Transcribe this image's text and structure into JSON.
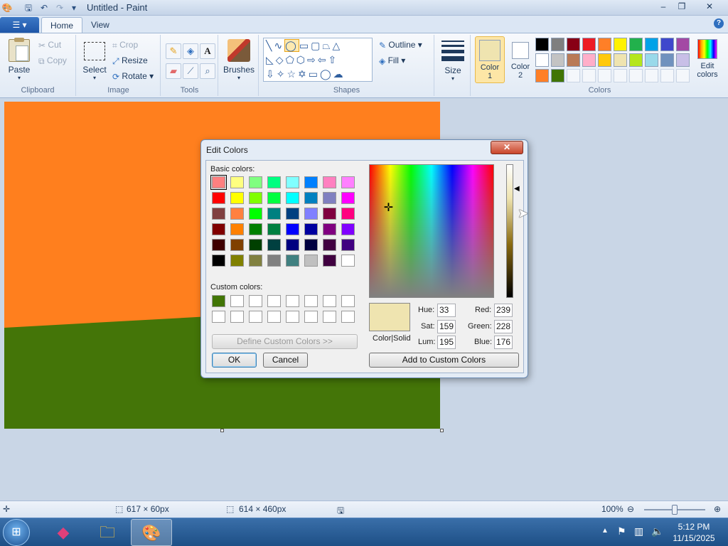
{
  "window": {
    "title": "Untitled - Paint",
    "minimize": "‒",
    "maximize": "❐",
    "close": "✕"
  },
  "tabs": {
    "file": "☰ ▾",
    "home": "Home",
    "view": "View"
  },
  "ribbon": {
    "clipboard": {
      "label": "Clipboard",
      "paste": "Paste",
      "cut": "Cut",
      "copy": "Copy"
    },
    "image": {
      "label": "Image",
      "select": "Select",
      "crop": "Crop",
      "resize": "Resize",
      "rotate": "Rotate"
    },
    "tools": {
      "label": "Tools"
    },
    "brushes": {
      "label": "Brushes"
    },
    "shapes": {
      "label": "Shapes",
      "outline": "Outline",
      "fill": "Fill"
    },
    "size": {
      "label": "Size"
    },
    "colors": {
      "label": "Colors",
      "color1": "Color 1",
      "color1_line1": "Color",
      "color1_line2": "1",
      "color2": "Color 2",
      "color2_line1": "Color",
      "color2_line2": "2",
      "edit": "Edit colors",
      "edit_line1": "Edit",
      "edit_line2": "colors",
      "color1_value": "#efe4b0",
      "color2_value": "#ffffff",
      "palette_row1": [
        "#000000",
        "#7f7f7f",
        "#880015",
        "#ed1c24",
        "#ff7f27",
        "#fff200",
        "#22b14c",
        "#00a2e8",
        "#3f48cc",
        "#a349a4"
      ],
      "palette_row2": [
        "#ffffff",
        "#c3c3c3",
        "#b97a57",
        "#ffaec9",
        "#ffc90e",
        "#efe4b0",
        "#b5e61d",
        "#99d9ea",
        "#7092be",
        "#c8bfe7"
      ],
      "palette_row3": [
        "#ff7f27",
        "#417505",
        "",
        "",
        "",
        "",
        "",
        "",
        "",
        ""
      ]
    }
  },
  "canvas": {
    "top_color": "#ff7f1e",
    "bottom_color": "#447508"
  },
  "dialog": {
    "title": "Edit Colors",
    "close": "✕",
    "basic_colors_label": "Basic colors:",
    "basic_colors": [
      [
        "#ff8080",
        "#ffff80",
        "#80ff80",
        "#00ff80",
        "#80ffff",
        "#0080ff",
        "#ff80c0",
        "#ff80ff"
      ],
      [
        "#ff0000",
        "#ffff00",
        "#80ff00",
        "#00ff40",
        "#00ffff",
        "#0080c0",
        "#8080c0",
        "#ff00ff"
      ],
      [
        "#804040",
        "#ff8040",
        "#00ff00",
        "#008080",
        "#004080",
        "#8080ff",
        "#800040",
        "#ff0080"
      ],
      [
        "#800000",
        "#ff8000",
        "#008000",
        "#008040",
        "#0000ff",
        "#0000a0",
        "#800080",
        "#8000ff"
      ],
      [
        "#400000",
        "#804000",
        "#004000",
        "#004040",
        "#000080",
        "#000040",
        "#400040",
        "#400080"
      ],
      [
        "#000000",
        "#808000",
        "#808040",
        "#808080",
        "#408080",
        "#c0c0c0",
        "#400040",
        "#ffffff"
      ]
    ],
    "custom_colors_label": "Custom colors:",
    "custom_colors": [
      [
        "#417505",
        "#ffffff",
        "#ffffff",
        "#ffffff",
        "#ffffff",
        "#ffffff",
        "#ffffff",
        "#ffffff"
      ],
      [
        "#ffffff",
        "#ffffff",
        "#ffffff",
        "#ffffff",
        "#ffffff",
        "#ffffff",
        "#ffffff",
        "#ffffff"
      ]
    ],
    "define_custom": "Define Custom Colors >>",
    "ok": "OK",
    "cancel": "Cancel",
    "color_solid": "Color|Solid",
    "preview_color": "#efe4b0",
    "hue_label": "Hue:",
    "hue": "33",
    "sat_label": "Sat:",
    "sat": "159",
    "lum_label": "Lum:",
    "lum": "195",
    "red_label": "Red:",
    "red": "239",
    "green_label": "Green:",
    "green": "228",
    "blue_label": "Blue:",
    "blue": "176",
    "add_custom": "Add to Custom Colors"
  },
  "status": {
    "selection": "617 × 60px",
    "size": "614 × 460px",
    "zoom": "100%"
  },
  "taskbar": {
    "time": "5:12 PM",
    "date": "11/15/2025"
  }
}
